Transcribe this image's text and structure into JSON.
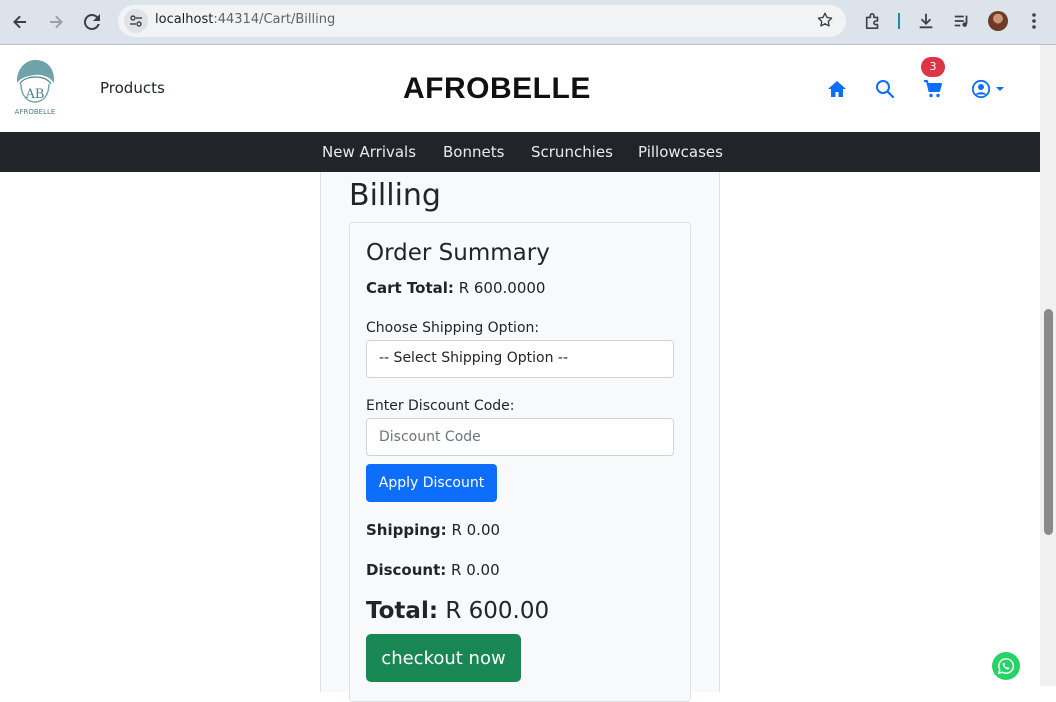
{
  "browser": {
    "url_host": "localhost",
    "url_path": ":44314/Cart/Billing",
    "icons": [
      "back-icon",
      "forward-icon",
      "reload-icon",
      "site-info-icon",
      "bookmark-star-icon",
      "extensions-icon",
      "download-icon",
      "media-controls-icon",
      "profile-avatar",
      "more-menu-icon"
    ]
  },
  "header": {
    "logo_text": "AB",
    "logo_subtext": "AFROBELLE",
    "products_label": "Products",
    "brand": "AFROBELLE",
    "cart_count": "3"
  },
  "categories": [
    {
      "label": "New Arrivals"
    },
    {
      "label": "Bonnets"
    },
    {
      "label": "Scrunchies"
    },
    {
      "label": "Pillowcases"
    }
  ],
  "billing": {
    "page_title": "Billing",
    "card_title": "Order Summary",
    "cart_total_label": "Cart Total:",
    "cart_total_value": "R 600.0000",
    "shipping_option_label": "Choose Shipping Option:",
    "shipping_option_selected": "-- Select Shipping Option --",
    "discount_label": "Enter Discount Code:",
    "discount_placeholder": "Discount Code",
    "apply_discount_label": "Apply Discount",
    "shipping_label": "Shipping:",
    "shipping_value": "R 0.00",
    "discount_amount_label": "Discount:",
    "discount_amount_value": "R 0.00",
    "total_label": "Total:",
    "total_value": "R 600.00",
    "checkout_label": "checkout now"
  },
  "colors": {
    "primary": "#0d6efd",
    "success": "#198754",
    "danger": "#dc3545",
    "navbar": "#212529"
  }
}
